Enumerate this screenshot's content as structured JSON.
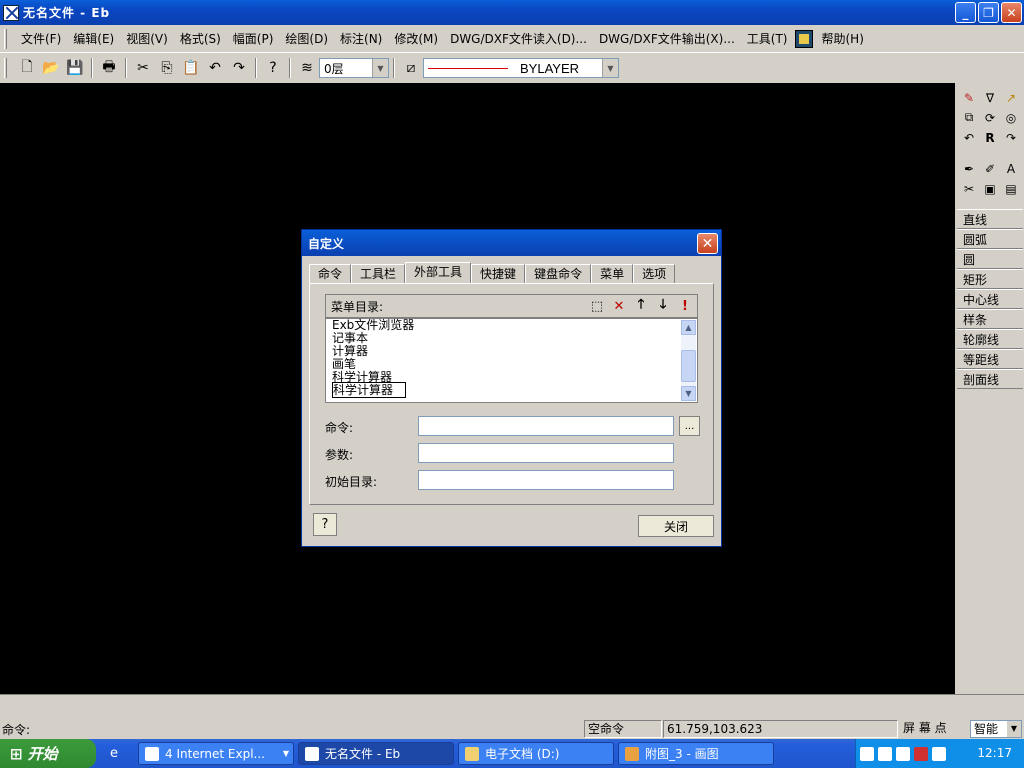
{
  "window": {
    "title": "无名文件 - Eb"
  },
  "menubar": [
    "文件(F)",
    "编辑(E)",
    "视图(V)",
    "格式(S)",
    "幅面(P)",
    "绘图(D)",
    "标注(N)",
    "修改(M)",
    "DWG/DXF文件读入(D)...",
    "DWG/DXF文件输出(X)...",
    "工具(T)",
    "帮助(H)"
  ],
  "toolbar": {
    "layer_value": "0层",
    "linetype_value": "BYLAYER"
  },
  "right_panel": {
    "icons_top": [
      "eraser-icon",
      "fillet-icon",
      "arrow-icon",
      "copy-icon",
      "rotate-icon",
      "scale-icon",
      "undo-icon",
      "R",
      "redo-icon"
    ],
    "icons_mid": [
      "pen-icon",
      "edit-icon",
      "text-icon",
      "trim-icon",
      "block-icon",
      "attach-icon"
    ],
    "commands": [
      "直线",
      "圆弧",
      "圆",
      "矩形",
      "中心线",
      "样条",
      "轮廓线",
      "等距线",
      "剖面线"
    ]
  },
  "dialog": {
    "title": "自定义",
    "tabs": [
      "命令",
      "工具栏",
      "外部工具",
      "快捷键",
      "键盘命令",
      "菜单",
      "选项"
    ],
    "active_tab": "外部工具",
    "list_header": "菜单目录:",
    "list_items": [
      "Exb文件浏览器",
      "记事本",
      "计算器",
      "画笔",
      "科学计算器",
      "科学计算器"
    ],
    "fields": {
      "command_label": "命令:",
      "params_label": "参数:",
      "init_dir_label": "初始目录:",
      "command_value": "",
      "params_value": "",
      "init_dir_value": ""
    },
    "browse_label": "...",
    "close_label": "关闭",
    "help_label": "?"
  },
  "status": {
    "prompt": "命令:",
    "empty_cmd": "空命令",
    "coords": "61.759,103.623",
    "snap": "屏 幕 点",
    "mode": "智能"
  },
  "taskbar": {
    "start_label": "开始",
    "tasks": [
      "4 Internet Expl...",
      "无名文件 - Eb",
      "电子文档 (D:)",
      "附图_3 - 画图"
    ],
    "clock": "12:17"
  }
}
